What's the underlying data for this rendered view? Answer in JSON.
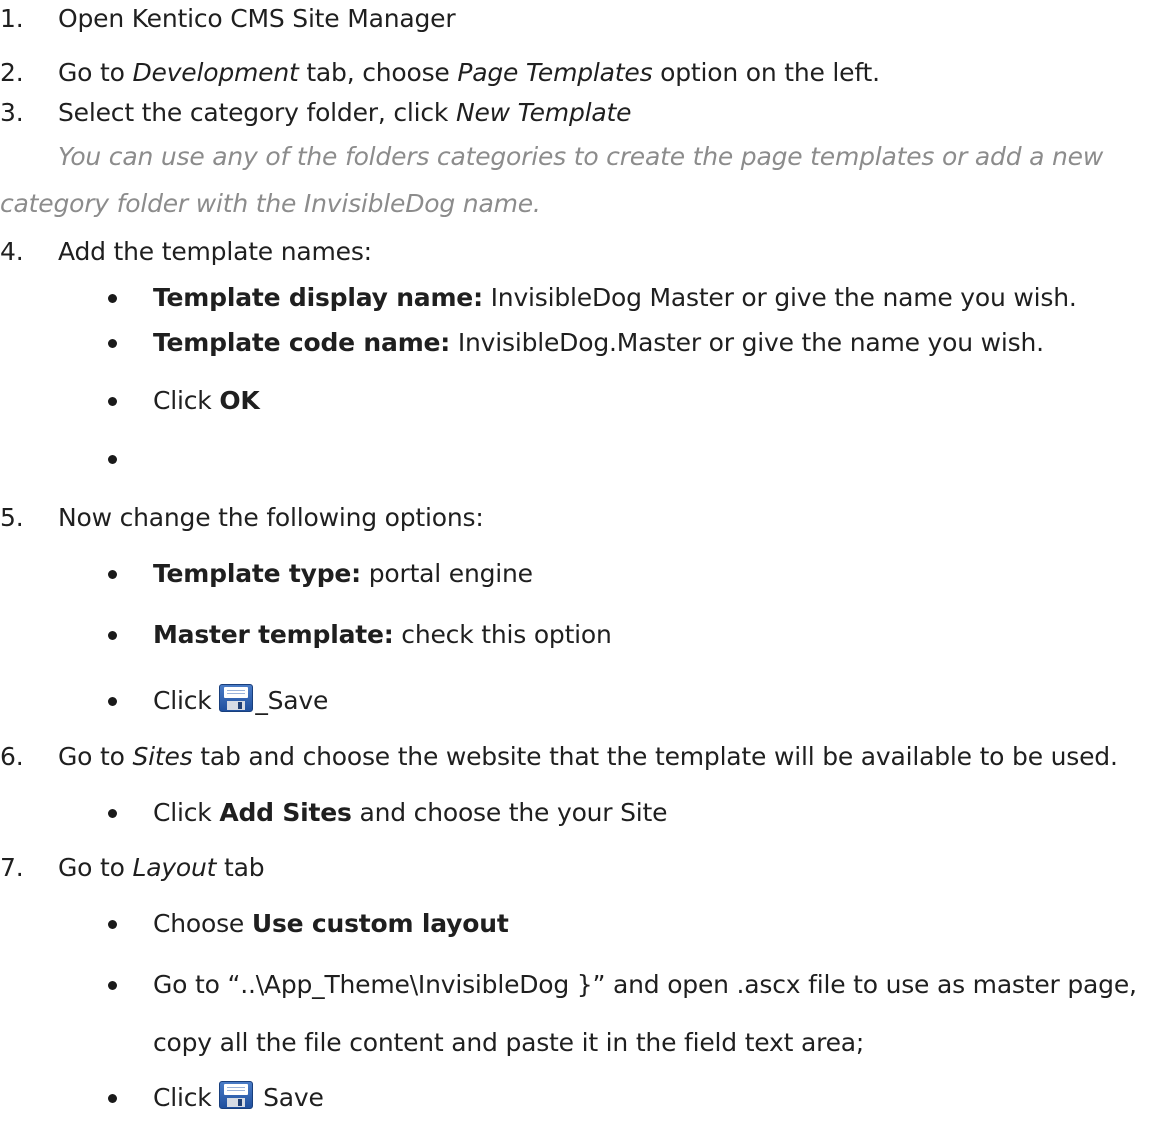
{
  "steps": [
    {
      "num": "1.",
      "text": "Open Kentico CMS Site Manager"
    },
    {
      "num": "2.",
      "pre": "Go to ",
      "em1": "Development",
      "mid": " tab, choose ",
      "em2": "Page Templates",
      "post": " option on the left."
    },
    {
      "num": "3.",
      "pre": "Select the category folder, click ",
      "em": "New Template",
      "note_line1": "You can use any of the folders categories to create the page templates or add a new",
      "note_line2": "category folder with the InvisibleDog name."
    },
    {
      "num": "4.",
      "text": "Add the template names:",
      "bullets": [
        {
          "label": "Template display name:",
          "text": " InvisibleDog Master or give the name you wish."
        },
        {
          "label": "Template code name:",
          "text": " InvisibleDog.Master or give the name you wish."
        },
        {
          "pre": "Click ",
          "label": "OK"
        },
        {
          "text": ""
        }
      ]
    },
    {
      "num": "5.",
      "text": "Now change the following options:",
      "bullets": [
        {
          "label": "Template type:",
          "text": " portal engine"
        },
        {
          "label": "Master template:",
          "text": " check this option"
        },
        {
          "pre": "Click ",
          "icon": "save-icon",
          "text": "_Save"
        }
      ]
    },
    {
      "num": "6.",
      "pre": "Go to ",
      "em": "Sites",
      "post": " tab and choose the website that the template will be available to be used.",
      "bullets": [
        {
          "pre": "Click ",
          "label": "Add Sites",
          "text": " and choose the your Site"
        }
      ]
    },
    {
      "num": "7.",
      "pre": "Go to ",
      "em": "Layout",
      "post": " tab",
      "bullets": [
        {
          "pre": "Choose ",
          "label": "Use custom layout"
        },
        {
          "line1": "Go to “..\\App_Theme\\InvisibleDog }” and open .ascx file to use as master page,",
          "line2": "copy all the file content and paste it in the field text area;"
        },
        {
          "pre": "Click ",
          "icon": "save-icon",
          "text": " Save"
        }
      ]
    }
  ]
}
